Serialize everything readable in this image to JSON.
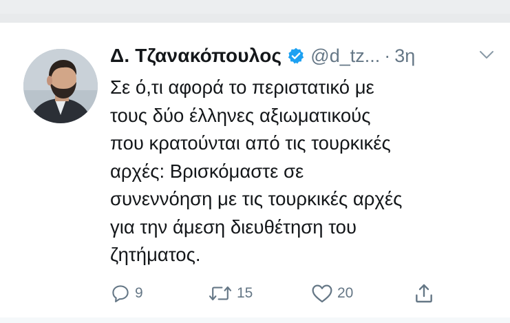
{
  "tweet": {
    "author_name": "Δ. Τζανακόπουλος",
    "handle": "@d_tz...",
    "separator": "·",
    "time": "3η",
    "text_lines": [
      "Σε ό,τι αφορά το περιστατικό με",
      "τους δύο έλληνες αξιωματικούς",
      "που κρατούνται από τις τουρκικές",
      "αρχές: Βρισκόμαστε σε",
      "συνεννόηση με τις τουρκικές αρχές",
      "για την άμεση διευθέτηση του",
      "ζητήματος."
    ]
  },
  "actions": {
    "reply_count": "9",
    "retweet_count": "15",
    "like_count": "20"
  },
  "icons": {
    "verified": "verified-badge-icon",
    "menu": "chevron-down-icon",
    "reply": "reply-icon",
    "retweet": "retweet-icon",
    "like": "heart-icon",
    "share": "share-icon"
  },
  "colors": {
    "verified": "#1da1f2",
    "text": "#14171a",
    "secondary": "#657786"
  }
}
